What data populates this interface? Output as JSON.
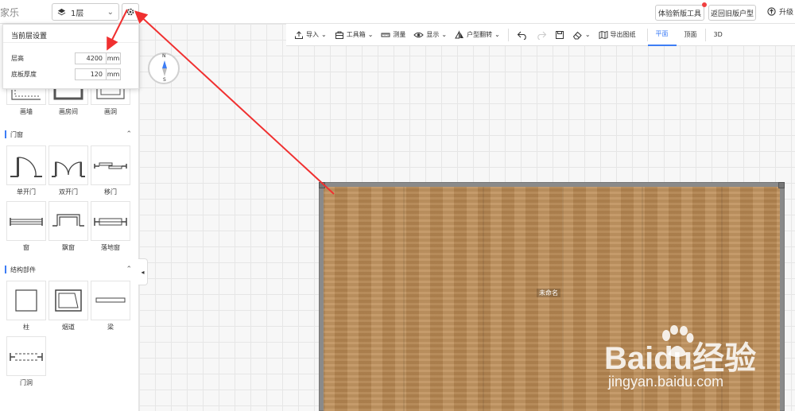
{
  "header": {
    "brand_fragment": "家乐",
    "floor_selected": "1层",
    "try_new_tool": "体验新版工具",
    "back_old_type": "返回旧版户型",
    "upgrade": "升级"
  },
  "floor_settings": {
    "title": "当前层设置",
    "height_label": "层高",
    "height_value": "4200",
    "height_unit": "mm",
    "thickness_label": "底板厚度",
    "thickness_value": "120",
    "thickness_unit": "mm"
  },
  "toolbar": {
    "import": "导入",
    "toolbox": "工具箱",
    "measure": "测量",
    "display": "显示",
    "flip": "户型翻转",
    "export": "导出图纸",
    "tabs": [
      "平面",
      "顶面",
      "3D"
    ]
  },
  "left_panel": {
    "draw_tools": [
      "画墙",
      "画房间",
      "画洞"
    ],
    "doors_section": "门窗",
    "doors": [
      "单开门",
      "双开门",
      "移门",
      "窗",
      "飘窗",
      "落地窗"
    ],
    "structure_section": "结构部件",
    "structure": [
      "柱",
      "烟道",
      "梁",
      "门洞"
    ]
  },
  "compass": {
    "n": "N",
    "s": "S"
  },
  "room": {
    "label": "未命名"
  },
  "watermark": {
    "main": "Baidu经验",
    "sub": "jingyan.baidu.com"
  },
  "colors": {
    "accent": "#3d7df5",
    "arrow": "#f03030",
    "floor": "#b98a55"
  }
}
